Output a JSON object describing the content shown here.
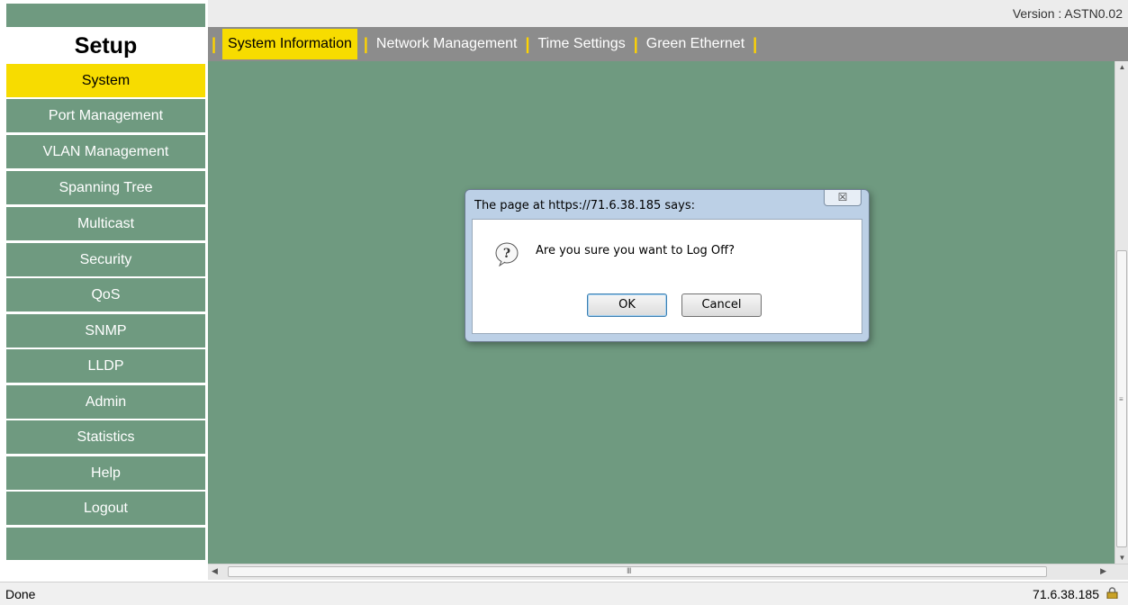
{
  "header": {
    "version_text": "Version : ASTN0.02"
  },
  "sidebar": {
    "title": "Setup",
    "items": [
      {
        "label": "System",
        "active": true
      },
      {
        "label": "Port Management",
        "active": false
      },
      {
        "label": "VLAN Management",
        "active": false
      },
      {
        "label": "Spanning Tree",
        "active": false
      },
      {
        "label": "Multicast",
        "active": false
      },
      {
        "label": "Security",
        "active": false
      },
      {
        "label": "QoS",
        "active": false
      },
      {
        "label": "SNMP",
        "active": false
      },
      {
        "label": "LLDP",
        "active": false
      },
      {
        "label": "Admin",
        "active": false
      },
      {
        "label": "Statistics",
        "active": false
      },
      {
        "label": "Help",
        "active": false
      },
      {
        "label": "Logout",
        "active": false
      }
    ]
  },
  "tabs": [
    {
      "label": "System Information",
      "active": true
    },
    {
      "label": "Network Management",
      "active": false
    },
    {
      "label": "Time Settings",
      "active": false
    },
    {
      "label": "Green Ethernet",
      "active": false
    }
  ],
  "dialog": {
    "title": "The page at https://71.6.38.185 says:",
    "message": "Are you sure you want to Log Off?",
    "ok_label": "OK",
    "cancel_label": "Cancel",
    "close_glyph": "☒",
    "icon": "question-icon"
  },
  "statusbar": {
    "text": "Done",
    "host": "71.6.38.185",
    "icon": "lock-icon"
  },
  "colors": {
    "accent": "#f7dc00",
    "sidebar": "#6f9a80",
    "content": "#6f9a80",
    "tabbar": "#8c8c8c"
  }
}
